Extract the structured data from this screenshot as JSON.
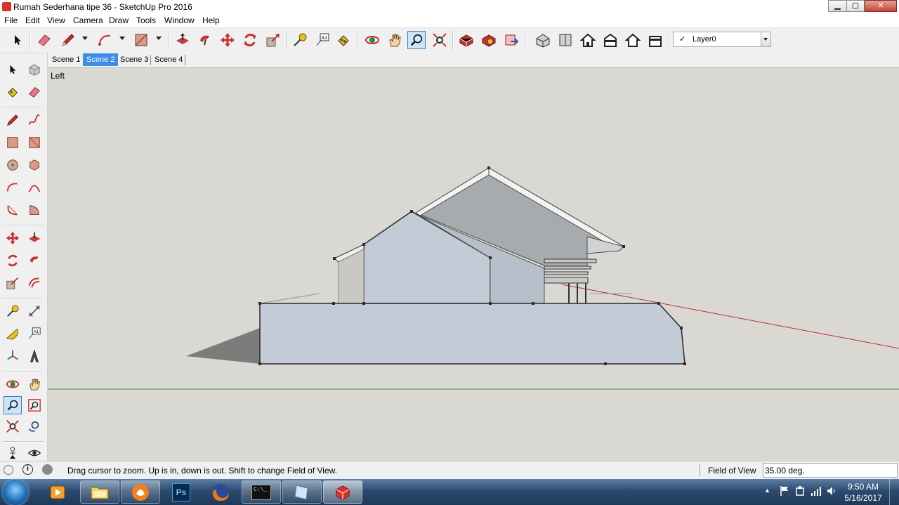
{
  "window": {
    "title": "Rumah Sederhana tipe 36 - SketchUp Pro 2016",
    "minimize": "▁",
    "maximize": "▢",
    "close": "✕"
  },
  "menubar": {
    "items": [
      "File",
      "Edit",
      "View",
      "Camera",
      "Draw",
      "Tools",
      "Window",
      "Help"
    ]
  },
  "toolbar": {
    "tools": [
      "select-icon",
      "eraser-icon",
      "line-pencil-icon",
      "arc-icon",
      "rectangle-icon",
      "push-pull-icon",
      "follow-me-icon",
      "move-icon",
      "rotate-icon",
      "scale-icon",
      "tape-measure-icon",
      "text-icon",
      "paint-bucket-icon",
      "orbit-icon",
      "pan-icon",
      "zoom-icon",
      "zoom-extents-icon",
      "3d-warehouse-icon",
      "extension-warehouse-icon",
      "layout-send-icon",
      "iso-view-icon",
      "top-view-icon",
      "front-view-icon",
      "right-view-icon",
      "back-view-icon",
      "left-view-icon"
    ],
    "active_tool": "zoom-icon"
  },
  "layer": {
    "check": "✓",
    "name": "Layer0"
  },
  "scenes": {
    "tabs": [
      "Scene 1",
      "Scene 2",
      "Scene 3",
      "Scene 4"
    ],
    "active": "Scene 2"
  },
  "viewport": {
    "view_name": "Left",
    "colors": {
      "background": "#d9d8d2",
      "wall": "#c2cbd6",
      "roof": "#a8abae",
      "axis_red": "#c03030",
      "axis_green": "#2e9a2e"
    }
  },
  "statusbar": {
    "message": "Drag cursor to zoom.  Up is in, down is out. Shift to change Field of View.",
    "vcb_label": "Field of View",
    "vcb_value": "35.00 deg."
  },
  "taskbar": {
    "apps": [
      "media-player-icon",
      "file-explorer-icon",
      "uc-browser-icon",
      "photoshop-icon",
      "firefox-icon",
      "command-prompt-icon",
      "notepad-icon",
      "sketchup-icon"
    ],
    "photoshop_label": "Ps",
    "cmd_label": "C:\\_",
    "tray": {
      "show_hidden": "▲"
    },
    "time": "9:50 AM",
    "date": "5/16/2017"
  }
}
